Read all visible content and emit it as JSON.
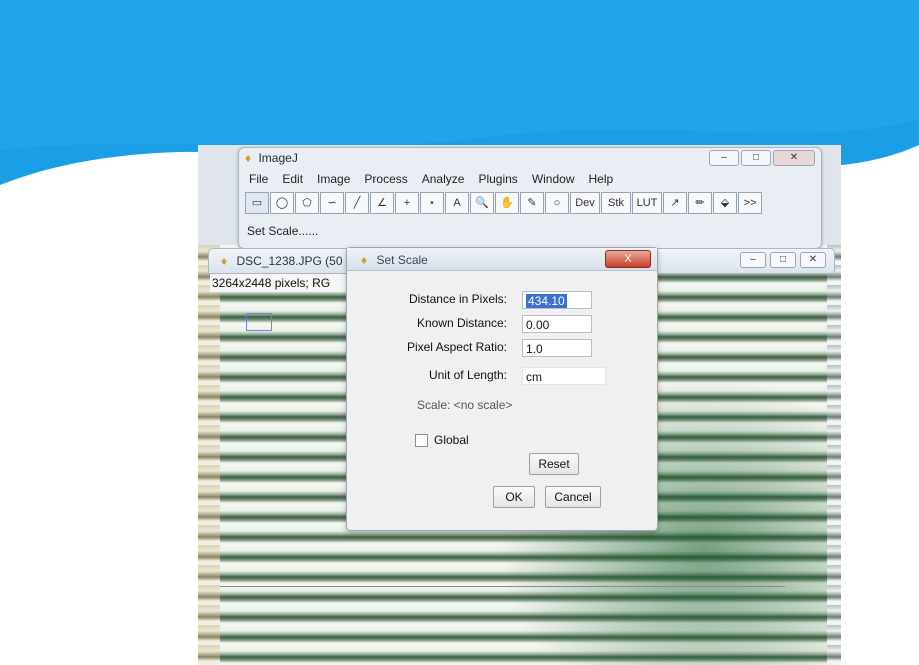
{
  "colors": {
    "slide_blue": "#1a9ee6",
    "slide_light_blue": "#6cc4f0",
    "dialog_bg": "#f0f0f0",
    "selection": "#3b6fd1"
  },
  "imagej": {
    "title": "ImageJ",
    "menu": [
      "File",
      "Edit",
      "Image",
      "Process",
      "Analyze",
      "Plugins",
      "Window",
      "Help"
    ],
    "tools": [
      {
        "icon": "rectangle-icon",
        "glyph": "▭"
      },
      {
        "icon": "oval-icon",
        "glyph": "◯"
      },
      {
        "icon": "polygon-icon",
        "glyph": "⬠"
      },
      {
        "icon": "freehand-icon",
        "glyph": "∽"
      },
      {
        "icon": "line-icon",
        "glyph": "╱"
      },
      {
        "icon": "angle-icon",
        "glyph": "∠"
      },
      {
        "icon": "point-icon",
        "glyph": "+"
      },
      {
        "icon": "wand-icon",
        "glyph": "⋆"
      },
      {
        "icon": "text-icon",
        "glyph": "A"
      },
      {
        "icon": "magnifier-icon",
        "glyph": "🔍"
      },
      {
        "icon": "hand-icon",
        "glyph": "✋"
      },
      {
        "icon": "dropper-icon",
        "glyph": "✎"
      },
      {
        "icon": "circle-tool-icon",
        "glyph": "○"
      },
      {
        "icon": "dev-icon",
        "glyph": "Dev"
      },
      {
        "icon": "stk-icon",
        "glyph": "Stk"
      },
      {
        "icon": "lut-icon",
        "glyph": "LUT"
      },
      {
        "icon": "arrow-icon",
        "glyph": "↗"
      },
      {
        "icon": "pencil-icon",
        "glyph": "✏"
      },
      {
        "icon": "flood-icon",
        "glyph": "⬙"
      },
      {
        "icon": "more-tools-icon",
        "glyph": ">>"
      }
    ],
    "status": "Set Scale......"
  },
  "image_window": {
    "title": "DSC_1238.JPG (50",
    "info": "3264x2448 pixels; RG"
  },
  "dialog": {
    "title": "Set Scale",
    "close_label": "X",
    "distance_label": "Distance in Pixels:",
    "distance_value": "434.10",
    "known_label": "Known Distance:",
    "known_value": "0.00",
    "aspect_label": "Pixel Aspect Ratio:",
    "aspect_value": "1.0",
    "unit_label": "Unit of Length:",
    "unit_value": "cm",
    "scale_text": "Scale: <no scale>",
    "global_label": "Global",
    "reset_label": "Reset",
    "ok_label": "OK",
    "cancel_label": "Cancel"
  }
}
